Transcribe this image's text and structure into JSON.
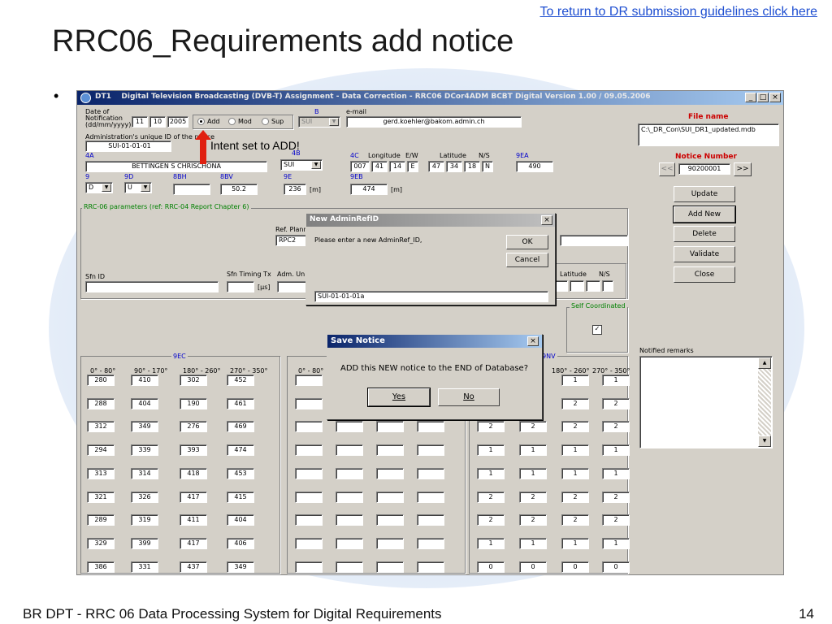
{
  "slide": {
    "top_link": "To return to DR submission guidelines click here",
    "title": "RRC06_Requirements add notice",
    "bullet": "•",
    "footer_left": "BR DPT - RRC 06 Data Processing System for Digital Requirements",
    "page_number": "14",
    "annotation": "Intent set to ADD!"
  },
  "window": {
    "app": "DT1",
    "title": "Digital Television Broadcasting (DVB-T) Assignment - Data Correction -  RRC06 DCor4ADM BCBT Digital Version 1.00 / 09.05.2006",
    "minimize": "_",
    "maximize": "□",
    "close": "×"
  },
  "form": {
    "date_label": "Date of Notification (dd/mm/yyyy)",
    "date_day": "11",
    "date_month": "10",
    "date_year": "2005",
    "intent_add": "Add",
    "intent_mod": "Mod",
    "intent_sup": "Sup",
    "b_label": "B",
    "b_value": "SUI",
    "email_label": "e-mail",
    "email_value": "gerd.koehler@bakom.admin.ch",
    "admin_id_label": "Administration's unique ID of the notice",
    "admin_id_value": "SUI-01-01-01",
    "lbl_4a": "4A",
    "site_name": "BETTINGEN S CHRISCHONA",
    "lbl_4b": "4B",
    "country": "SUI",
    "lbl_4c": "4C",
    "longitude_label": "Longitude",
    "ew_label": "E/W",
    "latitude_label": "Latitude",
    "ns_label": "N/S",
    "lon_deg": "007",
    "lon_min": "41",
    "lon_sec": "14",
    "lon_ew": "E",
    "lat_deg": "47",
    "lat_min": "34",
    "lat_sec": "18",
    "lat_ns": "N",
    "lbl_9ea": "9EA",
    "val_9ea": "490",
    "lbl_9": "9",
    "val_9": "D",
    "lbl_9d": "9D",
    "val_9d": "U",
    "lbl_8bh": "8BH",
    "val_8bh": "",
    "lbl_8bv": "8BV",
    "val_8bv": "50.2",
    "lbl_9e": "9E",
    "val_9e": "236",
    "unit_m": "[m]",
    "lbl_9eb": "9EB",
    "val_9eb": "474",
    "rrc_params_label": "RRC-06 parameters (ref: RRC-04 Report Chapter 6)",
    "ref_plan_label": "Ref. Plann",
    "ref_plan_value": "RPC2",
    "sfn_id_label": "Sfn ID",
    "sfn_timing_label": "Sfn Timing Tx",
    "us_unit": "[µs]",
    "adm_uni_label": "Adm. Uni",
    "latitude2_label": "Latitude",
    "ns2_label": "N/S",
    "self_coord_label": "Self Coordinated",
    "lbl_9ec": "9EC",
    "lbl_9nv": "9NV",
    "sector_headers": [
      "0° - 80°",
      "90° - 170°",
      "180° - 260°",
      "270° - 350°"
    ],
    "col2_first_header": "0° - 80°",
    "col3_headers": [
      "180° - 260°",
      "270° - 350°"
    ],
    "notified_remarks_label": "Notified remarks"
  },
  "grid_9ec": [
    [
      "280",
      "410",
      "302",
      "452"
    ],
    [
      "288",
      "404",
      "190",
      "461"
    ],
    [
      "312",
      "349",
      "276",
      "469"
    ],
    [
      "294",
      "339",
      "393",
      "474"
    ],
    [
      "313",
      "314",
      "418",
      "453"
    ],
    [
      "321",
      "326",
      "417",
      "415"
    ],
    [
      "289",
      "319",
      "411",
      "404"
    ],
    [
      "329",
      "399",
      "417",
      "406"
    ],
    [
      "386",
      "331",
      "437",
      "349"
    ]
  ],
  "grid_9nv": [
    [
      "",
      "",
      "1",
      "1"
    ],
    [
      "",
      "",
      "2",
      "2"
    ],
    [
      "2",
      "2",
      "2",
      "2"
    ],
    [
      "1",
      "1",
      "1",
      "1"
    ],
    [
      "1",
      "1",
      "1",
      "1"
    ],
    [
      "2",
      "2",
      "2",
      "2"
    ],
    [
      "2",
      "2",
      "2",
      "2"
    ],
    [
      "1",
      "1",
      "1",
      "1"
    ],
    [
      "0",
      "0",
      "0",
      "0"
    ]
  ],
  "sidebar": {
    "file_name_label": "File name",
    "file_name_value": "C:\\_DR_Con\\SUI_DR1_updated.mdb",
    "notice_number_label": "Notice Number",
    "notice_number_value": "90200001",
    "prev": "<<",
    "next": ">>",
    "buttons": [
      "Update",
      "Add New",
      "Delete",
      "Validate",
      "Close"
    ]
  },
  "dialog_adminref": {
    "title": "New AdminRefID",
    "prompt": "Please enter a new AdminRef_ID,",
    "ok": "OK",
    "cancel": "Cancel",
    "value": "SUI-01-01-01a"
  },
  "dialog_save": {
    "title": "Save Notice",
    "message": "ADD this NEW notice to the END of Database?",
    "yes": "Yes",
    "no": "No"
  }
}
